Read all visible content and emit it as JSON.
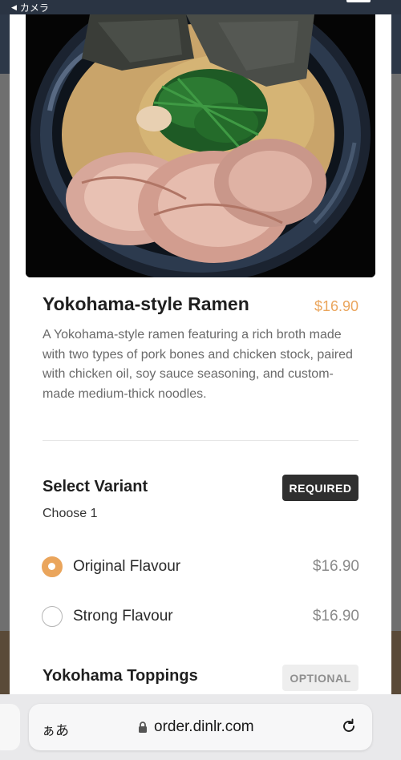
{
  "status_bar": {
    "back_label": "カメラ"
  },
  "dish": {
    "image_alt": "Bowl of Yokohama-style ramen with chashu pork, spinach and nori",
    "title": "Yokohama-style Ramen",
    "price": "$16.90",
    "description": "A Yokohama-style ramen featuring a rich broth made with two types of pork bones and chicken stock, paired with chicken oil, soy sauce seasoning, and custom-made medium-thick noodles."
  },
  "variant_section": {
    "title": "Select Variant",
    "badge": "REQUIRED",
    "hint": "Choose 1",
    "options": [
      {
        "label": "Original Flavour",
        "price": "$16.90",
        "selected": true
      },
      {
        "label": "Strong Flavour",
        "price": "$16.90",
        "selected": false
      }
    ]
  },
  "toppings_section": {
    "title": "Yokohama Toppings",
    "badge": "OPTIONAL"
  },
  "browser": {
    "text_size_button": "ぁあ",
    "url": "order.dinlr.com"
  },
  "colors": {
    "accent": "#eaa55c",
    "required_badge_bg": "#2f2f2f",
    "optional_badge_bg": "#eeeeee"
  }
}
